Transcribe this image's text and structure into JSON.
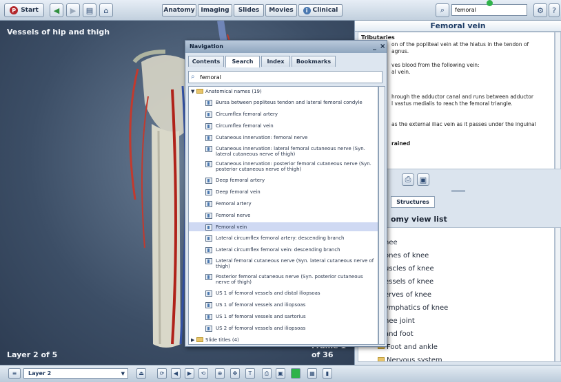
{
  "toolbar": {
    "start_label": "Start",
    "tabs": [
      "Anatomy",
      "Imaging",
      "Slides",
      "Movies",
      "Clinical"
    ],
    "search_value": "femoral"
  },
  "viewport": {
    "title": "Vessels of hip and thigh",
    "layer_text": "Layer 2 of 5",
    "frame_text": "Frame 1 of 36"
  },
  "right_panel": {
    "title": "Femoral vein",
    "heading": "Tributaries",
    "lines": [
      "on of the popliteal vein at the hiatus in the tendon of",
      "agnus.",
      "ves blood from the following vein:",
      "al vein.",
      "hrough the adductor canal and runs between adductor",
      "l vastus medialis to reach the femoral triangle.",
      "as the external iliac vein as it passes under the inguinal",
      "rained"
    ],
    "lower_tab": "Structures",
    "list_title": "omy view list",
    "tree_items": [
      "nee",
      "ones of knee",
      "uscles of knee",
      "essels of knee",
      "erves of knee",
      "ymphatics of knee",
      "nee joint",
      "and foot",
      "Foot and ankle",
      "Nervous system"
    ]
  },
  "navigation": {
    "title": "Navigation",
    "minimize": "_",
    "close": "×",
    "tabs": [
      "Contents",
      "Search",
      "Index",
      "Bookmarks"
    ],
    "search_value": "femoral",
    "group_label": "Anatomical names (19)",
    "items": [
      "Bursa between popliteus tendon and lateral femoral condyle",
      "Circumflex femoral artery",
      "Circumflex femoral vein",
      "Cutaneous innervation: femoral nerve",
      "Cutaneous innervation: lateral femoral cutaneous nerve (Syn. lateral cutaneous nerve of thigh)",
      "Cutaneous innervation: posterior femoral cutaneous nerve (Syn. posterior cutaneous nerve of thigh)",
      "Deep femoral artery",
      "Deep femoral vein",
      "Femoral artery",
      "Femoral nerve",
      "Femoral vein",
      "Lateral circumflex femoral artery: descending branch",
      "Lateral circumflex femoral vein: descending branch",
      "Lateral femoral cutaneous nerve (Syn. lateral cutaneous nerve of thigh)",
      "Posterior femoral cutaneous nerve (Syn. posterior cutaneous nerve of thigh)",
      "US 1 of femoral vessels and distal iliopsoas",
      "US 1 of femoral vessels and iliopsoas",
      "US 1 of femoral vessels and sartorius",
      "US 2 of femoral vessels and iliopsoas"
    ],
    "selected_item": "Femoral vein",
    "slide_group_label": "Slide titles (4)"
  },
  "bottom": {
    "layer_value": "Layer 2"
  },
  "colors": {
    "accent": "#1f3d66",
    "status_green": "#2fb34a"
  }
}
